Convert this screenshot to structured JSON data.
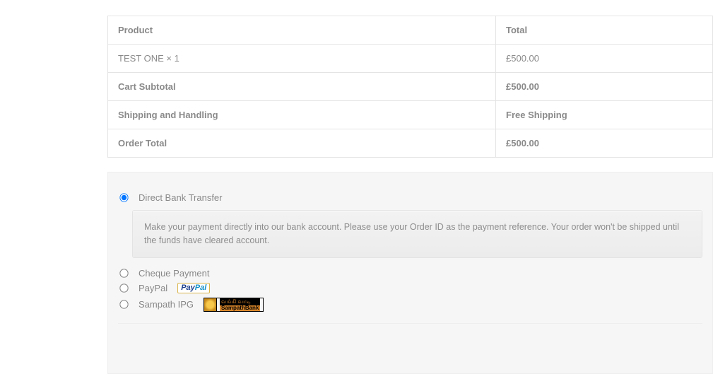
{
  "order_table": {
    "headers": {
      "product": "Product",
      "total": "Total"
    },
    "rows": [
      {
        "product": "TEST ONE × 1",
        "total": "£500.00"
      }
    ],
    "subtotal": {
      "label": "Cart Subtotal",
      "value": "£500.00"
    },
    "shipping": {
      "label": "Shipping and Handling",
      "value": "Free Shipping"
    },
    "total": {
      "label": "Order Total",
      "value": "£500.00"
    }
  },
  "payments": {
    "options": [
      {
        "label": "Direct Bank Transfer",
        "selected": true,
        "badge": null
      },
      {
        "label": "Cheque Payment",
        "selected": false,
        "badge": null
      },
      {
        "label": "PayPal",
        "selected": false,
        "badge": "paypal"
      },
      {
        "label": "Sampath IPG",
        "selected": false,
        "badge": "sampath"
      }
    ],
    "description": "Make your payment directly into our bank account. Please use your Order ID as the payment reference. Your order won't be shipped until the funds have cleared account.",
    "sampath_text1": "வங்கி வாடி",
    "sampath_text2": "SampathBank",
    "paypal_p1": "Pay",
    "paypal_p2": "Pal"
  }
}
